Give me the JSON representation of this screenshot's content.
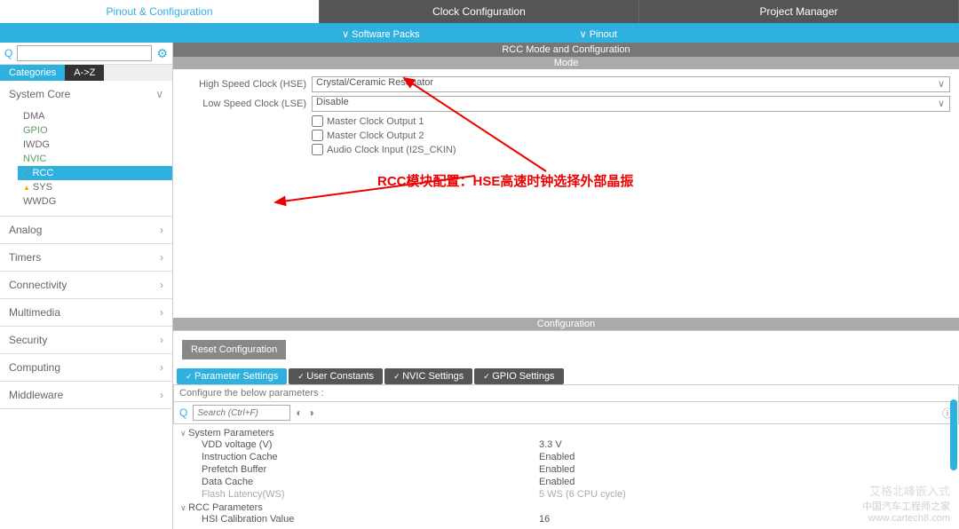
{
  "tabs": [
    "Pinout & Configuration",
    "Clock Configuration",
    "Project Manager"
  ],
  "subbar": {
    "sw": "∨  Software Packs",
    "pin": "∨  Pinout"
  },
  "cattabs": {
    "cat": "Categories",
    "az": "A->Z"
  },
  "sidebar": {
    "core": {
      "title": "System Core",
      "items": [
        "DMA",
        "GPIO",
        "IWDG",
        "NVIC",
        "RCC",
        "SYS",
        "WWDG"
      ]
    },
    "groups": [
      "Analog",
      "Timers",
      "Connectivity",
      "Multimedia",
      "Security",
      "Computing",
      "Middleware"
    ]
  },
  "panel": {
    "title": "RCC Mode and Configuration",
    "mode": "Mode",
    "hse_label": "High Speed Clock (HSE)",
    "hse_value": "Crystal/Ceramic Resonator",
    "lse_label": "Low Speed Clock (LSE)",
    "lse_value": "Disable",
    "mco1": "Master Clock Output 1",
    "mco2": "Master Clock Output 2",
    "audio": "Audio Clock Input (I2S_CKIN)",
    "config": "Configuration",
    "reset": "Reset Configuration",
    "subtabs": [
      "Parameter Settings",
      "User Constants",
      "NVIC Settings",
      "GPIO Settings"
    ],
    "hint": "Configure the below parameters :",
    "search_ph": "Search (Ctrl+F)"
  },
  "params": {
    "sys": {
      "title": "System Parameters",
      "rows": [
        {
          "name": "VDD voltage (V)",
          "val": "3.3 V"
        },
        {
          "name": "Instruction Cache",
          "val": "Enabled"
        },
        {
          "name": "Prefetch Buffer",
          "val": "Enabled"
        },
        {
          "name": "Data Cache",
          "val": "Enabled"
        },
        {
          "name": "Flash Latency(WS)",
          "val": "5 WS (6 CPU cycle)",
          "dim": true
        }
      ]
    },
    "rcc": {
      "title": "RCC Parameters",
      "rows": [
        {
          "name": "HSI Calibration Value",
          "val": "16"
        }
      ]
    }
  },
  "annotation": "RCC模块配置：HSE高速时钟选择外部晶振",
  "watermark": {
    "brand": "艾格北峰嵌入式",
    "site": "中国汽车工程师之家",
    "url": "www.cartech8.com"
  }
}
